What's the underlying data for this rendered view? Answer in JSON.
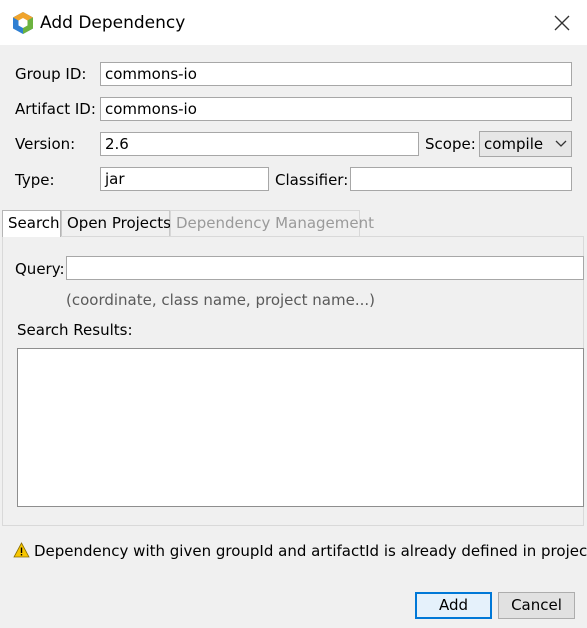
{
  "window": {
    "title": "Add Dependency",
    "app_icon": "netbeans-logo-icon",
    "close_icon": "close-icon"
  },
  "form": {
    "group_id_label": "Group ID:",
    "group_id_value": "commons-io",
    "artifact_id_label": "Artifact ID:",
    "artifact_id_value": "commons-io",
    "version_label": "Version:",
    "version_value": "2.6",
    "scope_label": "Scope:",
    "scope_value": "compile",
    "type_label": "Type:",
    "type_value": "jar",
    "classifier_label": "Classifier:",
    "classifier_value": ""
  },
  "tabs": [
    {
      "label": "Search",
      "state": "active"
    },
    {
      "label": "Open Projects",
      "state": "normal"
    },
    {
      "label": "Dependency Management",
      "state": "disabled"
    }
  ],
  "search": {
    "query_label": "Query:",
    "query_value": "",
    "hint": "(coordinate, class name, project name...)",
    "results_label": "Search Results:"
  },
  "warning": {
    "icon": "warning-icon",
    "text": "Dependency with given groupId and artifactId is already defined in project."
  },
  "buttons": {
    "add": "Add",
    "cancel": "Cancel"
  },
  "colors": {
    "accent": "#0078d7",
    "window_bg": "#f0f0f0",
    "titlebar_bg": "#ffffff",
    "warning_yellow": "#f7c600"
  }
}
